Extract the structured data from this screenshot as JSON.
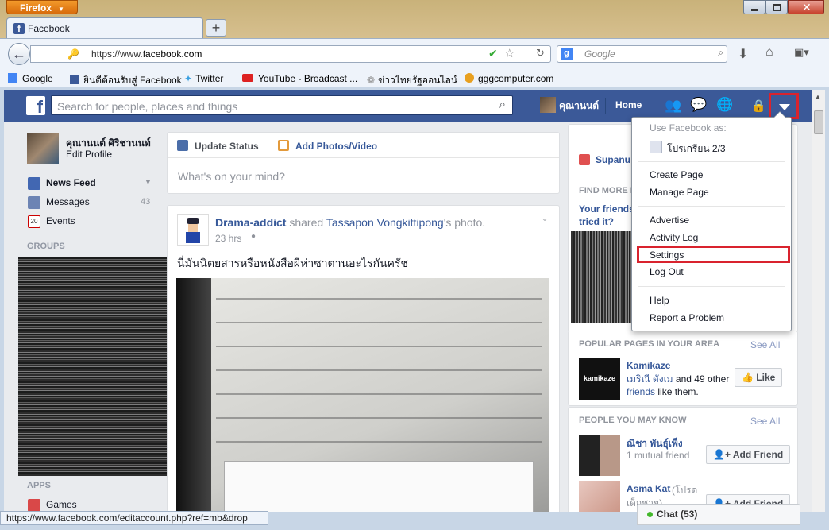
{
  "browser": {
    "app_button": "Firefox",
    "tab_title": "Facebook",
    "url_scheme": "https://www.",
    "url_domain": "facebook.com",
    "search_placeholder": "Google",
    "bookmarks": [
      "Google",
      "ยินดีต้อนรับสู่ Facebook",
      "Twitter",
      "YouTube - Broadcast ...",
      "ข่าวไทยรัฐออนไลน์",
      "gggcomputer.com"
    ],
    "status_url": "https://www.facebook.com/editaccount.php?ref=mb&drop"
  },
  "fb_header": {
    "search_placeholder": "Search for people, places and things",
    "user_name": "คุณานนต์",
    "home_label": "Home"
  },
  "left_nav": {
    "profile_name": "คุณานนต์ ศิริชานนท์",
    "edit_profile": "Edit Profile",
    "items": [
      {
        "label": "News Feed",
        "count": ""
      },
      {
        "label": "Messages",
        "count": "43"
      },
      {
        "label": "Events",
        "count": ""
      }
    ],
    "events_date": "20",
    "groups_header": "GROUPS",
    "apps_header": "APPS",
    "apps_first": "Games"
  },
  "composer": {
    "tab_status": "Update Status",
    "tab_photo": "Add Photos/Video",
    "placeholder": "What's on your mind?"
  },
  "post": {
    "author": "Drama-addict",
    "action": " shared ",
    "target": "Tassapon Vongkittipong",
    "target_suffix": "'s photo.",
    "time": "23 hrs",
    "text": "นี่มันนิตยสารหรือหนังสือผีห่าซาตานอะไรกันครัช"
  },
  "right_col": {
    "suggest_name_partial": "Supanu",
    "find_more": "FIND MORE F",
    "your_friends": "Your friends",
    "tried_it": "tried it?",
    "popular_header": "POPULAR PAGES IN YOUR AREA",
    "see_all": "See All",
    "page_name": "Kamikaze",
    "page_desc_1": "เมริณี ดังเม",
    "page_desc_2": " and 49 other",
    "page_desc_3": "friends",
    "page_desc_4": " like them.",
    "like_btn": "Like",
    "pymk_header": "PEOPLE YOU MAY KNOW",
    "person1_name": "ณิชา พันธุ์เพ็ง",
    "person1_mutual": "1 mutual friend",
    "person2_name": "Asma Kat",
    "person2_note": "(โปรด",
    "person2_note2": "เด็กชาย)",
    "add_friend": "Add Friend",
    "kamikaze_logo": "kamikaze"
  },
  "dropdown_menu": {
    "use_as_label": "Use Facebook as:",
    "page_item": "โปรเกรียน 2/3",
    "create_page": "Create Page",
    "manage_page": "Manage Page",
    "advertise": "Advertise",
    "activity_log": "Activity Log",
    "settings": "Settings",
    "log_out": "Log Out",
    "help": "Help",
    "report_problem": "Report a Problem"
  },
  "chat": {
    "label": "Chat (53)"
  },
  "colors": {
    "fb_blue": "#3b5998",
    "highlight_red": "#d9232e",
    "link": "#365899"
  }
}
